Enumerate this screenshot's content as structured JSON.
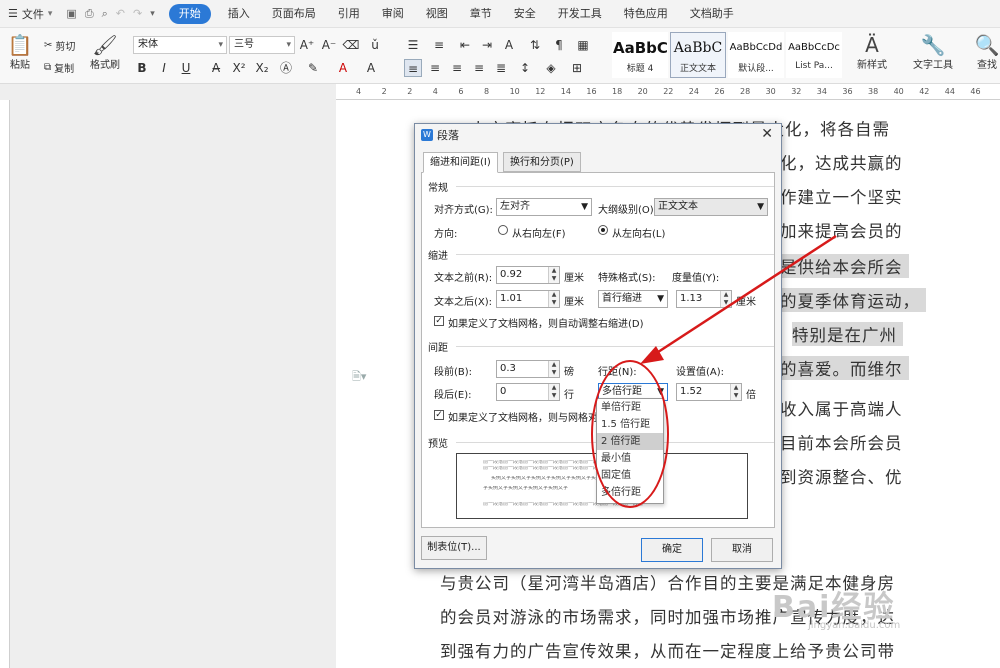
{
  "menubar": {
    "file_label": "文件",
    "tabs": [
      "开始",
      "插入",
      "页面布局",
      "引用",
      "审阅",
      "视图",
      "章节",
      "安全",
      "开发工具",
      "特色应用",
      "文档助手"
    ],
    "active_tab": "开始"
  },
  "ribbon": {
    "paste": "粘贴",
    "cut": "剪切",
    "copy": "复制",
    "format_painter": "格式刷",
    "font_name": "宋体",
    "font_size": "三号",
    "styles": [
      {
        "preview": "AaBbC",
        "caption": "标题 4"
      },
      {
        "preview": "AaBbC",
        "caption": "正文文本"
      },
      {
        "preview": "AaBbCcDd",
        "caption": "默认段..."
      },
      {
        "preview": "AaBbCcDc",
        "caption": "List Pa..."
      }
    ],
    "new_style": "新样式",
    "text_tools": "文字工具",
    "find": "查找"
  },
  "ruler_ticks": [
    "4",
    "2",
    "2",
    "4",
    "6",
    "8",
    "10",
    "12",
    "14",
    "16",
    "18",
    "20",
    "22",
    "24",
    "26",
    "28",
    "30",
    "32",
    "34",
    "36",
    "38",
    "40",
    "42",
    "44",
    "46"
  ],
  "document": {
    "lines": [
      "本方案旨在把双方各自的优势发挥到最大化，将各自需",
      "化，达成共赢的",
      "作建立一个坚实",
      "加来提高会员的",
      "是供给本会所会",
      "的夏季体育运动，",
      "特别是在广州",
      "的喜爱。而维尔",
      "收入属于高端人",
      "目前本会所会员",
      "到资源整合、优",
      "与贵公司（星河湾半岛酒店）合作目的主要是满足本健身房",
      "的会员对游泳的市场需求，同时加强市场推广宣传力度，达",
      "到强有力的广告宣传效果，从而在一定程度上给予贵公司带"
    ]
  },
  "dialog": {
    "title": "段落",
    "tabs": [
      "缩进和间距(I)",
      "换行和分页(P)"
    ],
    "general": {
      "section": "常规",
      "align_label": "对齐方式(G):",
      "align_value": "左对齐",
      "outline_label": "大纲级别(O):",
      "outline_value": "正文文本",
      "direction_label": "方向:",
      "rtl": "从右向左(F)",
      "ltr": "从左向右(L)"
    },
    "indent": {
      "section": "缩进",
      "before_label": "文本之前(R):",
      "before_value": "0.92",
      "before_unit": "厘米",
      "after_label": "文本之后(X):",
      "after_value": "1.01",
      "after_unit": "厘米",
      "special_label": "特殊格式(S):",
      "special_value": "首行缩进",
      "measure_label": "度量值(Y):",
      "measure_value": "1.13",
      "measure_unit": "厘米",
      "grid_check": "如果定义了文档网格，则自动调整右缩进(D)"
    },
    "spacing": {
      "section": "间距",
      "before_label": "段前(B):",
      "before_value": "0.3",
      "before_unit": "磅",
      "after_label": "段后(E):",
      "after_value": "0",
      "after_unit": "行",
      "line_label": "行距(N):",
      "line_value": "多倍行距",
      "set_label": "设置值(A):",
      "set_value": "1.52",
      "set_unit": "倍",
      "grid_check": "如果定义了文档网格，则与网格对"
    },
    "preview": {
      "section": "预览",
      "gray_text": "前一段落前一段落前一段落前一段落前一段落前一段落前一段落前一段落",
      "sample_text": "实例文字实例文字实例文字实例文字实例文字实例文字",
      "sample_text2": "字实例文字实例文字实例文字实例文字"
    },
    "tabs_button": "制表位(T)...",
    "ok": "确定",
    "cancel": "取消"
  },
  "line_spacing_options": [
    "单倍行距",
    "1.5 倍行距",
    "2 倍行距",
    "最小值",
    "固定值",
    "多倍行距"
  ],
  "selected_option_index": 2,
  "watermark": {
    "text": "Bai经验",
    "sub": "jingyan.baidu.com"
  },
  "colors": {
    "accent": "#2b79d6",
    "annotation": "#d71a1a"
  }
}
